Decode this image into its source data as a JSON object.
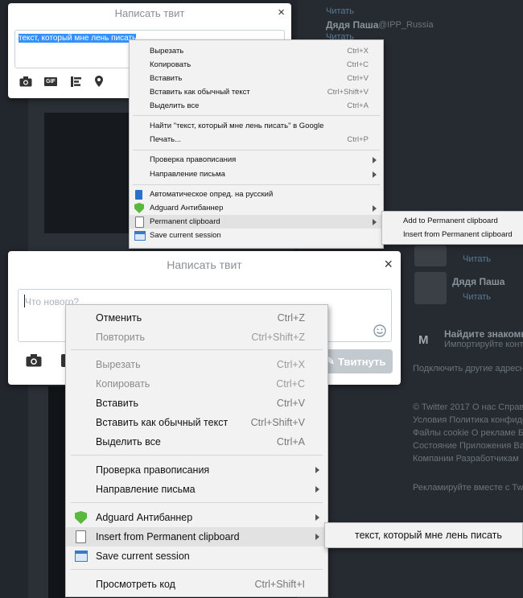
{
  "background": {
    "side": {
      "follow_1": "Читать",
      "user_name": "Дядя Паша",
      "user_handle": "@IPP_Russia",
      "follow_2": "Читать",
      "follow_3": "Читать",
      "follow_4": "Читать",
      "follow_5": "Читать",
      "contacts_title": "Найдите знакомых",
      "contacts_sub": "Импортируйте контакты",
      "connect": "Подключить другие адресные",
      "footer_1": "© Twitter 2017  О нас  Справка",
      "footer_2": "Условия  Политика конфиденц",
      "footer_3": "Файлы cookie  О рекламе  Бл",
      "footer_4": "Состояние  Приложения  Вак",
      "footer_5": "Компании  Разработчикам  ",
      "ads": "Рекламируйте вместе с Twitter"
    }
  },
  "dialog_top": {
    "title": "Написать твит",
    "close": "×",
    "text": "текст, который мне лень писать"
  },
  "dialog_main": {
    "title": "Написать твит",
    "close": "×",
    "placeholder": "Что нового?",
    "tweet_button": "Твитнуть"
  },
  "menu_small": {
    "items": [
      {
        "label": "Вырезать",
        "shortcut": "Ctrl+X"
      },
      {
        "label": "Копировать",
        "shortcut": "Ctrl+C"
      },
      {
        "label": "Вставить",
        "shortcut": "Ctrl+V"
      },
      {
        "label": "Вставить как обычный текст",
        "shortcut": "Ctrl+Shift+V"
      },
      {
        "label": "Выделить все",
        "shortcut": "Ctrl+A"
      },
      {
        "label": "Найти \"текст, который мне лень писать\" в Google",
        "shortcut": ""
      },
      {
        "label": "Печать...",
        "shortcut": "Ctrl+P"
      },
      {
        "label": "Проверка правописания",
        "shortcut": ""
      },
      {
        "label": "Направление письма",
        "shortcut": ""
      },
      {
        "label": "Автоматическое опред. на русский",
        "shortcut": ""
      },
      {
        "label": "Adguard Антибаннер",
        "shortcut": ""
      },
      {
        "label": "Permanent clipboard",
        "shortcut": ""
      },
      {
        "label": "Save current session",
        "shortcut": ""
      }
    ]
  },
  "submenu_small": {
    "items": [
      "Add to Permanent clipboard",
      "Insert from Permanent clipboard"
    ]
  },
  "menu_large": {
    "items": [
      {
        "label": "Отменить",
        "shortcut": "Ctrl+Z"
      },
      {
        "label": "Повторить",
        "shortcut": "Ctrl+Shift+Z"
      },
      {
        "label": "Вырезать",
        "shortcut": "Ctrl+X"
      },
      {
        "label": "Копировать",
        "shortcut": "Ctrl+C"
      },
      {
        "label": "Вставить",
        "shortcut": "Ctrl+V"
      },
      {
        "label": "Вставить как обычный текст",
        "shortcut": "Ctrl+Shift+V"
      },
      {
        "label": "Выделить все",
        "shortcut": "Ctrl+A"
      },
      {
        "label": "Проверка правописания",
        "shortcut": ""
      },
      {
        "label": "Направление письма",
        "shortcut": ""
      },
      {
        "label": "Adguard Антибаннер",
        "shortcut": ""
      },
      {
        "label": "Insert from Permanent clipboard",
        "shortcut": ""
      },
      {
        "label": "Save current session",
        "shortcut": ""
      },
      {
        "label": "Просмотреть код",
        "shortcut": "Ctrl+Shift+I"
      }
    ]
  },
  "submenu_large": {
    "items": [
      "текст, который мне лень писать"
    ]
  },
  "icons": {
    "camera": "camera-icon",
    "gif": "GIF",
    "poll": "poll-icon",
    "location": "location-icon",
    "emoji": "emoji-icon"
  },
  "colors": {
    "selection": "#3390ff",
    "adguard": "#59b83d",
    "tweet_button_disabled": "#c2c9cf"
  }
}
